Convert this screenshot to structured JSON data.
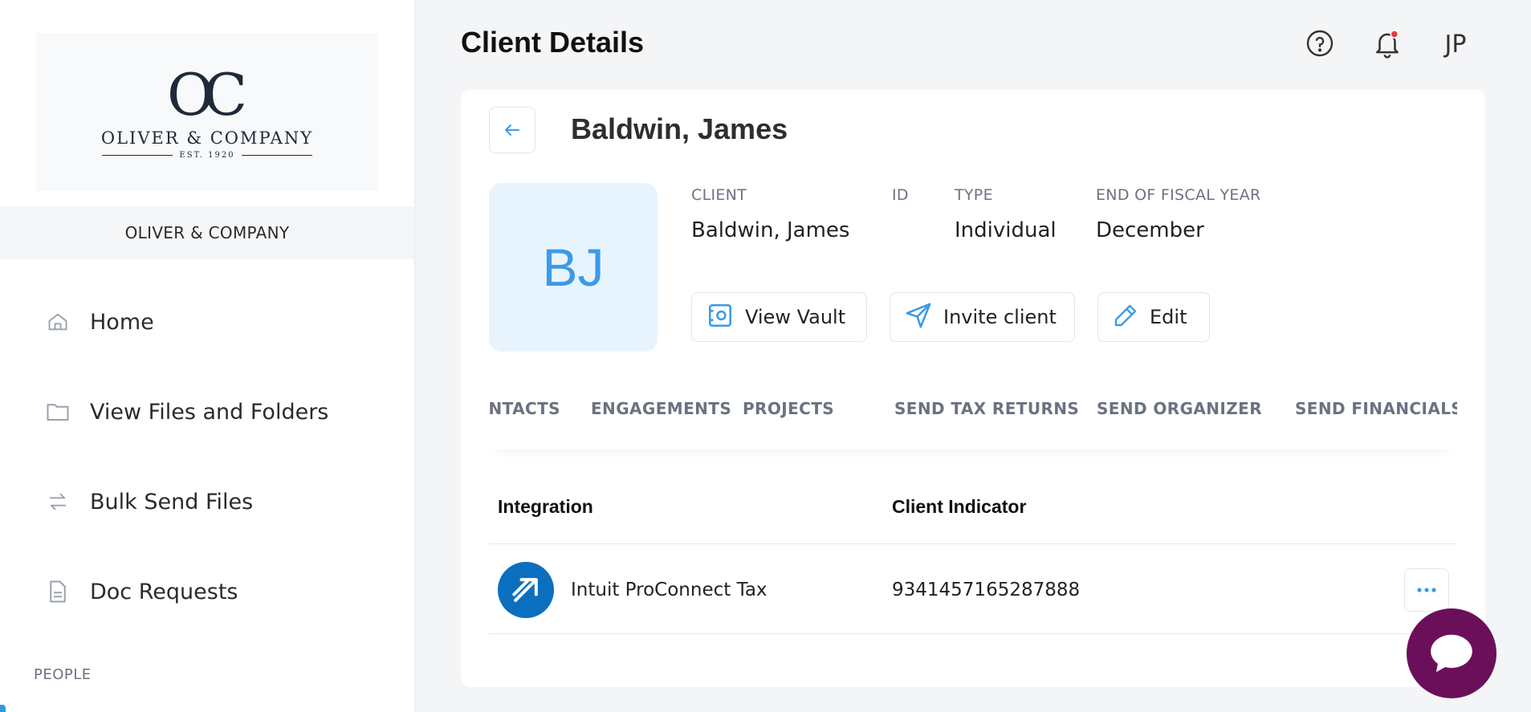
{
  "sidebar": {
    "logo": {
      "monogram": "OC",
      "name": "OLIVER & COMPANY",
      "est": "EST. 1920"
    },
    "firm_name": "OLIVER & COMPANY",
    "items": [
      {
        "label": "Home",
        "icon": "home-icon"
      },
      {
        "label": "View Files and Folders",
        "icon": "folder-icon"
      },
      {
        "label": "Bulk Send Files",
        "icon": "transfer-icon"
      },
      {
        "label": "Doc Requests",
        "icon": "document-icon"
      }
    ],
    "section_label": "PEOPLE"
  },
  "header": {
    "title": "Client Details",
    "user_initials": "JP",
    "icons": [
      "help-icon",
      "notification-bell-icon"
    ]
  },
  "client": {
    "title": "Baldwin, James",
    "initials": "BJ",
    "fields": [
      {
        "label": "CLIENT",
        "value": "Baldwin, James"
      },
      {
        "label": "ID",
        "value": ""
      },
      {
        "label": "TYPE",
        "value": "Individual"
      },
      {
        "label": "END OF FISCAL YEAR",
        "value": "December"
      }
    ],
    "actions": [
      {
        "label": "View Vault",
        "icon": "vault-icon"
      },
      {
        "label": "Invite client",
        "icon": "send-icon"
      },
      {
        "label": "Edit",
        "icon": "pencil-icon"
      }
    ]
  },
  "tabs": [
    "CONTACTS",
    "ENGAGEMENTS",
    "PROJECTS",
    "SEND TAX RETURNS",
    "SEND ORGANIZER",
    "SEND FINANCIALS"
  ],
  "table": {
    "columns": [
      "Integration",
      "Client Indicator"
    ],
    "rows": [
      {
        "integration": "Intuit ProConnect Tax",
        "indicator": "9341457165287888"
      }
    ]
  },
  "colors": {
    "accent": "#3b9ae8",
    "chat": "#6b0f5a",
    "notification_dot": "#e53945",
    "integration_logo": "#0b6fc0"
  }
}
